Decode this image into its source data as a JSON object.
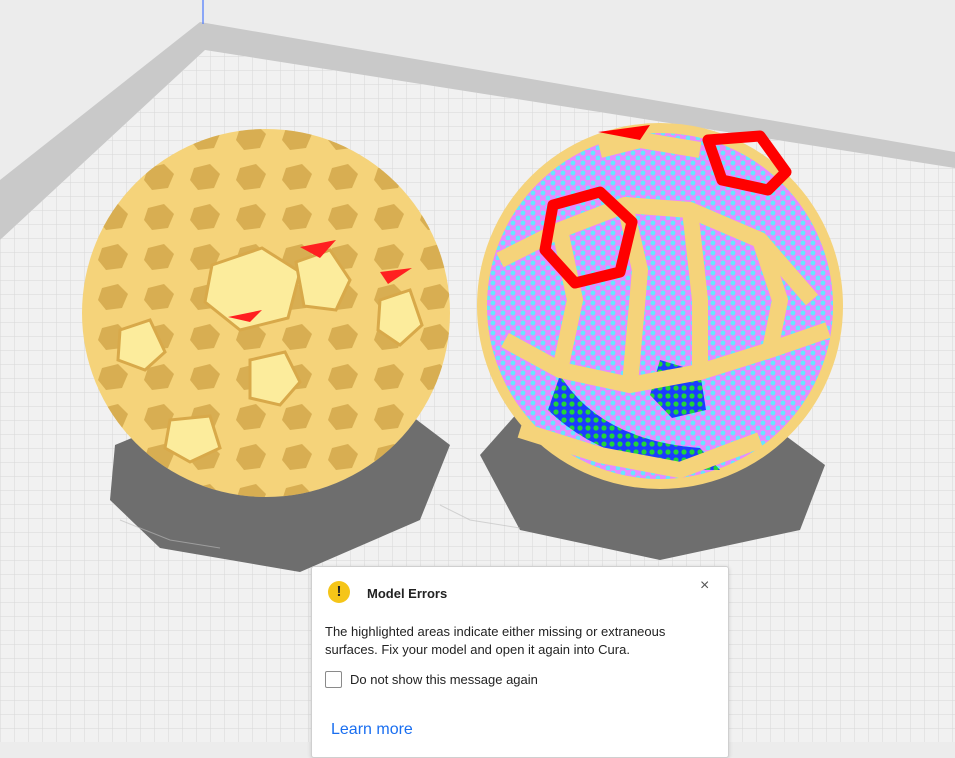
{
  "dialog": {
    "title": "Model Errors",
    "body": "The highlighted areas indicate either missing or extraneous surfaces. Fix your model and open it again into Cura.",
    "checkbox_label": "Do not show this message again",
    "checkbox_checked": false,
    "learn_more": "Learn more",
    "close_glyph": "×",
    "warning_glyph": "!"
  },
  "colors": {
    "model": "#f5d37a",
    "error_red": "#ff0000",
    "error_blue": "#1b3cff",
    "error_magenta": "#e78cff",
    "error_cyan": "#66e6ff",
    "error_green": "#22d43a",
    "link": "#196ef0",
    "warning": "#f5c518"
  }
}
